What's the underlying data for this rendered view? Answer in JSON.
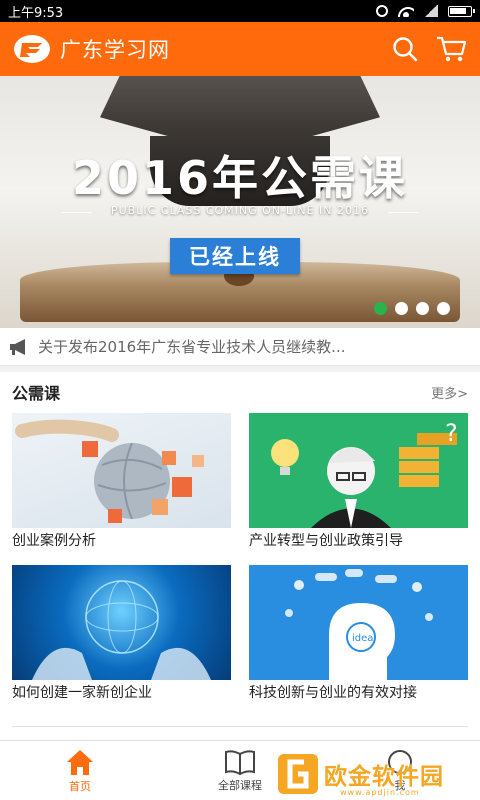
{
  "status_bar": {
    "time": "上午9:53"
  },
  "header": {
    "title": "广东学习网",
    "brand_color": "#ff6a0d"
  },
  "banner": {
    "headline": "2016年公需课",
    "subline": "PUBLIC CLASS COMING ON-LINE IN 2016",
    "tag": "已经上线",
    "slide_count": 4,
    "active_slide": 1
  },
  "notice": {
    "text": "关于发布2016年广东省专业技术人员继续教..."
  },
  "section": {
    "title": "公需课",
    "more": "更多>",
    "courses": [
      {
        "label": "创业案例分析",
        "icon": "cube-globe-illustration"
      },
      {
        "label": "产业转型与创业政策引导",
        "icon": "businessman-gold-illustration"
      },
      {
        "label": "如何创建一家新创企业",
        "icon": "hands-globe-illustration"
      },
      {
        "label": "科技创新与创业的有效对接",
        "icon": "idea-head-illustration"
      }
    ]
  },
  "bottom_nav": [
    {
      "label": "首页",
      "icon": "home-icon",
      "active": true
    },
    {
      "label": "全部课程",
      "icon": "book-icon",
      "active": false
    },
    {
      "label": "我",
      "icon": "user-icon",
      "active": false
    }
  ],
  "watermark": {
    "text": "欧金软件园",
    "url": "www.apdjin.com"
  }
}
